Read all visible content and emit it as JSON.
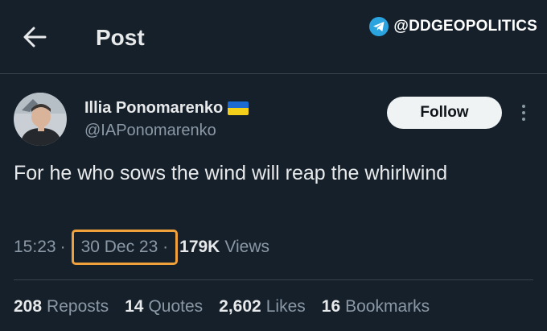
{
  "header": {
    "title": "Post",
    "back_icon": "arrow-left-icon"
  },
  "watermark": {
    "icon": "telegram-icon",
    "text": "@DDGEOPOLITICS",
    "color": "#2aa3df"
  },
  "author": {
    "display_name": "Illia Ponomarenko",
    "flag_icon": "ukraine-flag-icon",
    "handle": "@IAPonomarenko"
  },
  "follow_label": "Follow",
  "more_icon": "more-vertical-icon",
  "tweet": {
    "text": "For he who sows the wind will reap the whirlwind",
    "time": "15:23",
    "date": "30 Dec 23",
    "views_count": "179K",
    "views_label": "Views",
    "separator": "·"
  },
  "highlight_color": "#f0a13c",
  "stats": [
    {
      "num": "208",
      "label": "Reposts"
    },
    {
      "num": "14",
      "label": "Quotes"
    },
    {
      "num": "2,602",
      "label": "Likes"
    },
    {
      "num": "16",
      "label": "Bookmarks"
    }
  ],
  "colors": {
    "background": "#15202b",
    "text": "#e7e9ea",
    "secondary_text": "#8b98a5"
  }
}
